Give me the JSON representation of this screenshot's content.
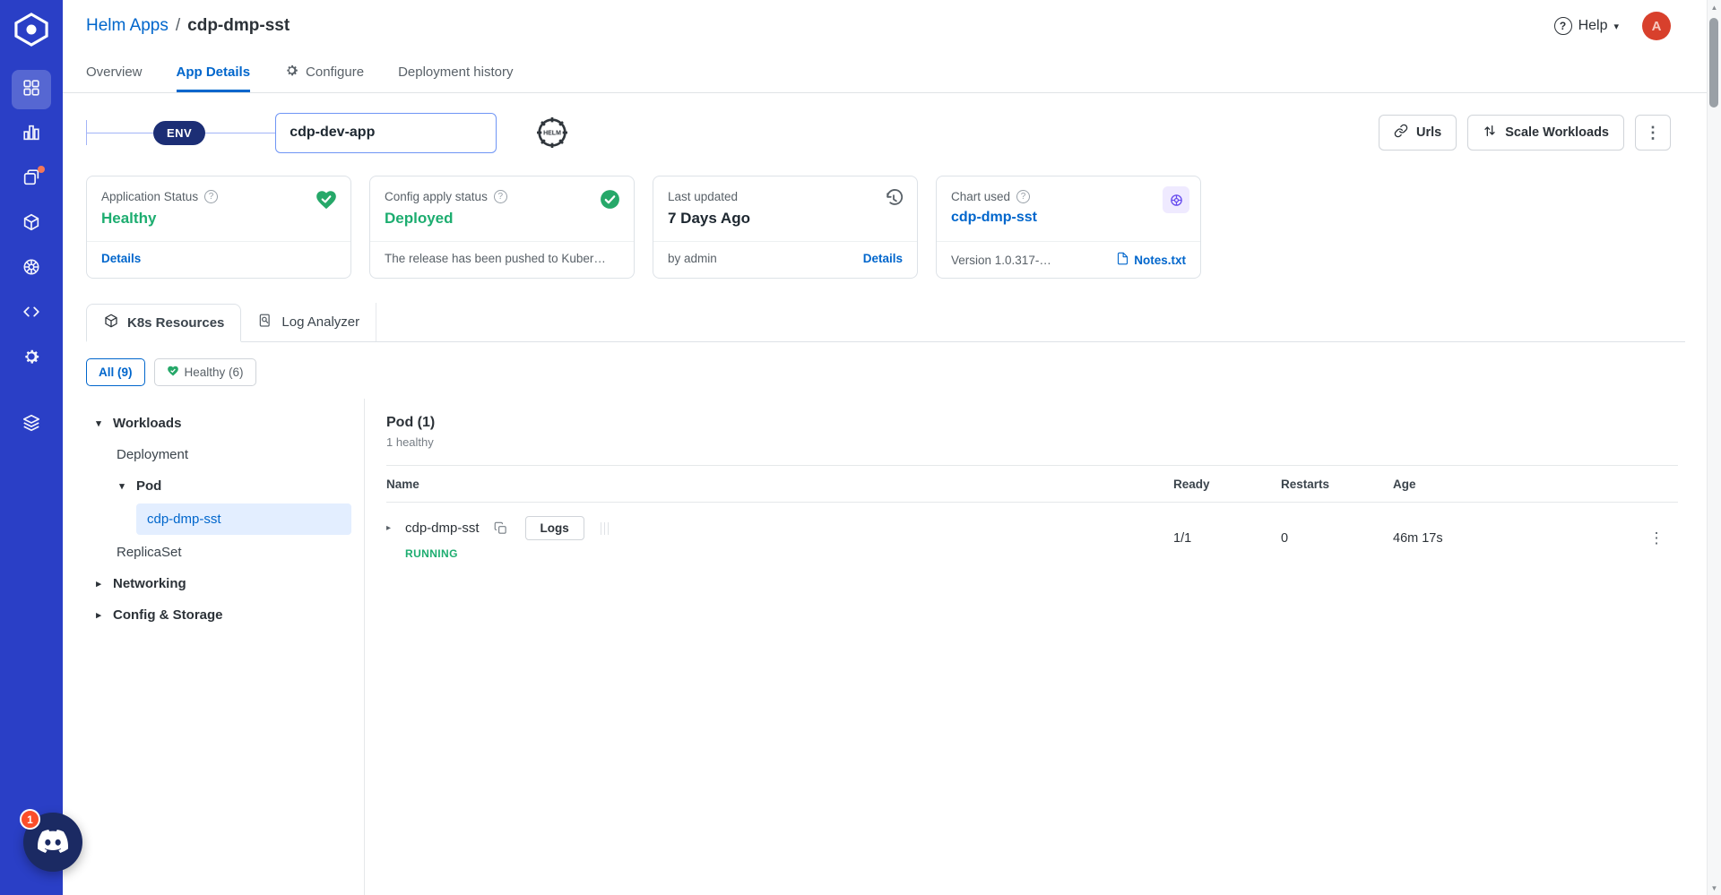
{
  "colors": {
    "accent": "#0066cc",
    "success_text": "#1dad70",
    "success_icon": "#26a869",
    "sidebar": "#2a3fc6",
    "chart_icon_purple": "#664bee",
    "notification_badge": "#fb4e2a",
    "selected_tree_bg": "#e3eeff"
  },
  "icons": {
    "question_mark": "?",
    "chevron_down": "▾",
    "triangle_down": "▾",
    "triangle_right": "▸",
    "kebab": "⋮",
    "scroll_up": "▲",
    "scroll_down": "▼"
  },
  "sidebar": {
    "chat_badge": "1"
  },
  "header": {
    "breadcrumb_parent": "Helm Apps",
    "breadcrumb_separator": "/",
    "breadcrumb_current": "cdp-dmp-sst",
    "help_label": "Help",
    "avatar_initial": "A"
  },
  "nav_tabs": {
    "overview": "Overview",
    "app_details": "App Details",
    "configure": "Configure",
    "deployment_history": "Deployment history"
  },
  "app_bar": {
    "env_label": "ENV",
    "app_name": "cdp-dev-app",
    "urls_label": "Urls",
    "scale_workloads_label": "Scale Workloads"
  },
  "status_cards": {
    "application_status": {
      "title": "Application Status",
      "value": "Healthy",
      "link": "Details"
    },
    "config_apply": {
      "title": "Config apply status",
      "value": "Deployed",
      "message": "The release has been pushed to Kuber…"
    },
    "last_updated": {
      "title": "Last updated",
      "value": "7 Days Ago",
      "by": "by admin",
      "link": "Details"
    },
    "chart_used": {
      "title": "Chart used",
      "value": "cdp-dmp-sst",
      "version": "Version 1.0.317-…",
      "link": "Notes.txt"
    }
  },
  "resource_tabs": {
    "k8s": "K8s Resources",
    "log_analyzer": "Log Analyzer"
  },
  "filters": {
    "all": "All (9)",
    "healthy": "Healthy (6)"
  },
  "tree": {
    "items": [
      {
        "label": "Workloads"
      },
      {
        "label": "Deployment"
      },
      {
        "label": "Pod"
      },
      {
        "label": "cdp-dmp-sst"
      },
      {
        "label": "ReplicaSet"
      },
      {
        "label": "Networking"
      },
      {
        "label": "Config & Storage"
      }
    ]
  },
  "pod_panel": {
    "title": "Pod (1)",
    "subtitle": "1 healthy",
    "columns": {
      "name": "Name",
      "ready": "Ready",
      "restarts": "Restarts",
      "age": "Age"
    },
    "rows": [
      {
        "name": "cdp-dmp-sst",
        "status": "RUNNING",
        "logs_label": "Logs",
        "ready": "1/1",
        "restarts": "0",
        "age": "46m 17s"
      }
    ]
  }
}
